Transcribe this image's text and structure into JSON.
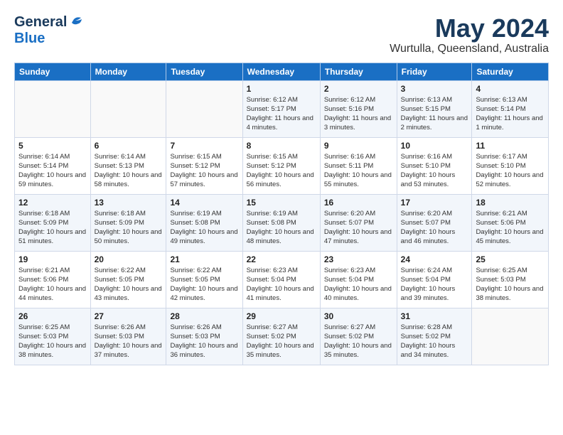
{
  "header": {
    "logo_general": "General",
    "logo_blue": "Blue",
    "title": "May 2024",
    "subtitle": "Wurtulla, Queensland, Australia"
  },
  "days_of_week": [
    "Sunday",
    "Monday",
    "Tuesday",
    "Wednesday",
    "Thursday",
    "Friday",
    "Saturday"
  ],
  "weeks": [
    [
      {
        "day": "",
        "info": ""
      },
      {
        "day": "",
        "info": ""
      },
      {
        "day": "",
        "info": ""
      },
      {
        "day": "1",
        "info": "Sunrise: 6:12 AM\nSunset: 5:17 PM\nDaylight: 11 hours\nand 4 minutes."
      },
      {
        "day": "2",
        "info": "Sunrise: 6:12 AM\nSunset: 5:16 PM\nDaylight: 11 hours\nand 3 minutes."
      },
      {
        "day": "3",
        "info": "Sunrise: 6:13 AM\nSunset: 5:15 PM\nDaylight: 11 hours\nand 2 minutes."
      },
      {
        "day": "4",
        "info": "Sunrise: 6:13 AM\nSunset: 5:14 PM\nDaylight: 11 hours\nand 1 minute."
      }
    ],
    [
      {
        "day": "5",
        "info": "Sunrise: 6:14 AM\nSunset: 5:14 PM\nDaylight: 10 hours\nand 59 minutes."
      },
      {
        "day": "6",
        "info": "Sunrise: 6:14 AM\nSunset: 5:13 PM\nDaylight: 10 hours\nand 58 minutes."
      },
      {
        "day": "7",
        "info": "Sunrise: 6:15 AM\nSunset: 5:12 PM\nDaylight: 10 hours\nand 57 minutes."
      },
      {
        "day": "8",
        "info": "Sunrise: 6:15 AM\nSunset: 5:12 PM\nDaylight: 10 hours\nand 56 minutes."
      },
      {
        "day": "9",
        "info": "Sunrise: 6:16 AM\nSunset: 5:11 PM\nDaylight: 10 hours\nand 55 minutes."
      },
      {
        "day": "10",
        "info": "Sunrise: 6:16 AM\nSunset: 5:10 PM\nDaylight: 10 hours\nand 53 minutes."
      },
      {
        "day": "11",
        "info": "Sunrise: 6:17 AM\nSunset: 5:10 PM\nDaylight: 10 hours\nand 52 minutes."
      }
    ],
    [
      {
        "day": "12",
        "info": "Sunrise: 6:18 AM\nSunset: 5:09 PM\nDaylight: 10 hours\nand 51 minutes."
      },
      {
        "day": "13",
        "info": "Sunrise: 6:18 AM\nSunset: 5:09 PM\nDaylight: 10 hours\nand 50 minutes."
      },
      {
        "day": "14",
        "info": "Sunrise: 6:19 AM\nSunset: 5:08 PM\nDaylight: 10 hours\nand 49 minutes."
      },
      {
        "day": "15",
        "info": "Sunrise: 6:19 AM\nSunset: 5:08 PM\nDaylight: 10 hours\nand 48 minutes."
      },
      {
        "day": "16",
        "info": "Sunrise: 6:20 AM\nSunset: 5:07 PM\nDaylight: 10 hours\nand 47 minutes."
      },
      {
        "day": "17",
        "info": "Sunrise: 6:20 AM\nSunset: 5:07 PM\nDaylight: 10 hours\nand 46 minutes."
      },
      {
        "day": "18",
        "info": "Sunrise: 6:21 AM\nSunset: 5:06 PM\nDaylight: 10 hours\nand 45 minutes."
      }
    ],
    [
      {
        "day": "19",
        "info": "Sunrise: 6:21 AM\nSunset: 5:06 PM\nDaylight: 10 hours\nand 44 minutes."
      },
      {
        "day": "20",
        "info": "Sunrise: 6:22 AM\nSunset: 5:05 PM\nDaylight: 10 hours\nand 43 minutes."
      },
      {
        "day": "21",
        "info": "Sunrise: 6:22 AM\nSunset: 5:05 PM\nDaylight: 10 hours\nand 42 minutes."
      },
      {
        "day": "22",
        "info": "Sunrise: 6:23 AM\nSunset: 5:04 PM\nDaylight: 10 hours\nand 41 minutes."
      },
      {
        "day": "23",
        "info": "Sunrise: 6:23 AM\nSunset: 5:04 PM\nDaylight: 10 hours\nand 40 minutes."
      },
      {
        "day": "24",
        "info": "Sunrise: 6:24 AM\nSunset: 5:04 PM\nDaylight: 10 hours\nand 39 minutes."
      },
      {
        "day": "25",
        "info": "Sunrise: 6:25 AM\nSunset: 5:03 PM\nDaylight: 10 hours\nand 38 minutes."
      }
    ],
    [
      {
        "day": "26",
        "info": "Sunrise: 6:25 AM\nSunset: 5:03 PM\nDaylight: 10 hours\nand 38 minutes."
      },
      {
        "day": "27",
        "info": "Sunrise: 6:26 AM\nSunset: 5:03 PM\nDaylight: 10 hours\nand 37 minutes."
      },
      {
        "day": "28",
        "info": "Sunrise: 6:26 AM\nSunset: 5:03 PM\nDaylight: 10 hours\nand 36 minutes."
      },
      {
        "day": "29",
        "info": "Sunrise: 6:27 AM\nSunset: 5:02 PM\nDaylight: 10 hours\nand 35 minutes."
      },
      {
        "day": "30",
        "info": "Sunrise: 6:27 AM\nSunset: 5:02 PM\nDaylight: 10 hours\nand 35 minutes."
      },
      {
        "day": "31",
        "info": "Sunrise: 6:28 AM\nSunset: 5:02 PM\nDaylight: 10 hours\nand 34 minutes."
      },
      {
        "day": "",
        "info": ""
      }
    ]
  ]
}
